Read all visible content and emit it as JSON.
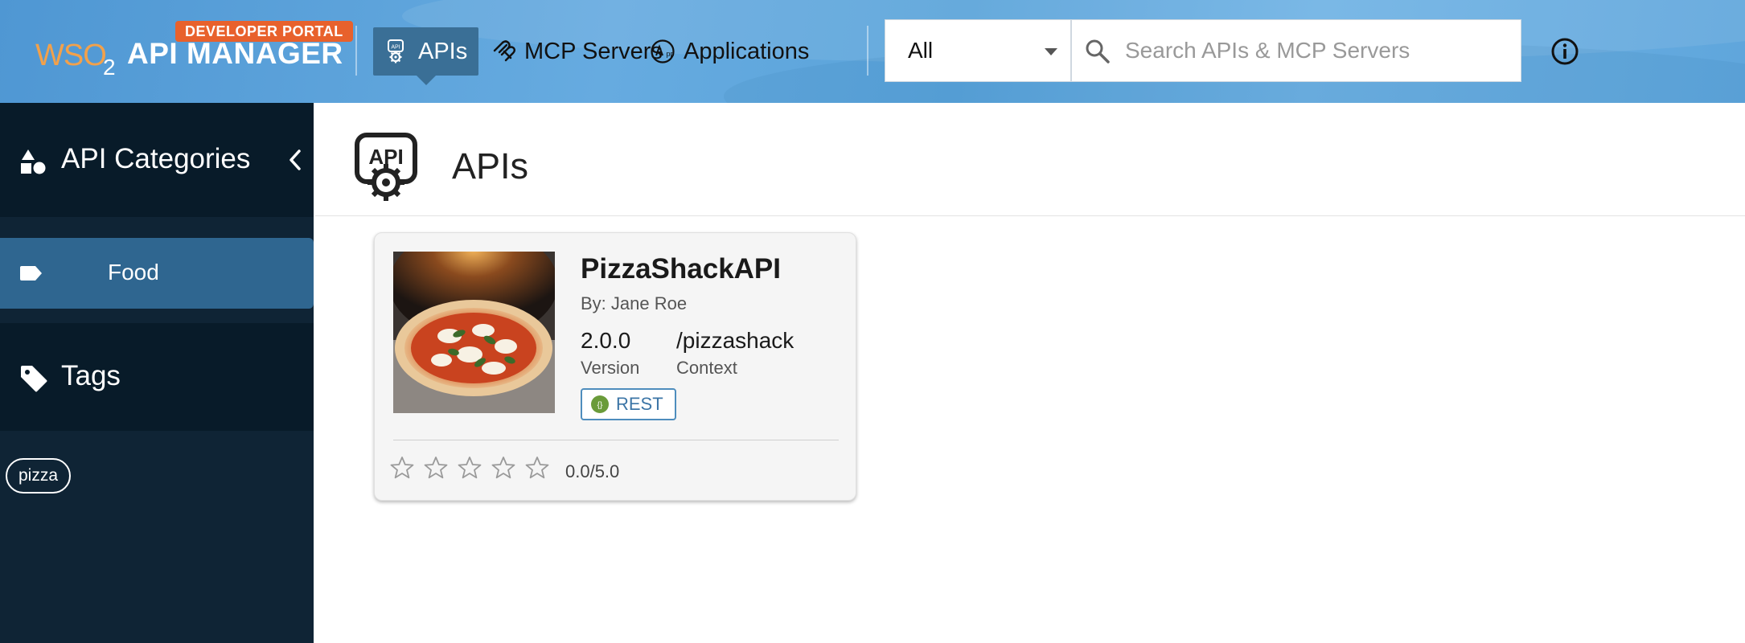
{
  "header": {
    "badge": "DEVELOPER PORTAL",
    "logo_wso": "WSO",
    "logo_two": "2",
    "product": "API MANAGER",
    "nav": [
      {
        "label": "APIs",
        "icon": "api-icon",
        "active": true
      },
      {
        "label": "MCP Servers",
        "icon": "mcp-icon",
        "active": false
      },
      {
        "label": "Applications",
        "icon": "applications-icon",
        "active": false
      }
    ],
    "filter_value": "All",
    "search_placeholder": "Search APIs & MCP Servers"
  },
  "sidebar": {
    "categories_label": "API Categories",
    "categories": [
      {
        "label": "Food",
        "selected": true
      }
    ],
    "tags_label": "Tags",
    "tags": [
      {
        "label": "pizza"
      }
    ]
  },
  "main": {
    "title": "APIs",
    "cards": [
      {
        "name": "PizzaShackAPI",
        "by": "By: Jane Roe",
        "version": "2.0.0",
        "version_label": "Version",
        "context": "/pizzashack",
        "context_label": "Context",
        "type": "REST",
        "rating": "0.0/5.0",
        "rating_value": 0,
        "rating_max": 5
      }
    ]
  },
  "colors": {
    "header_blue": "#5aa3da",
    "active_nav": "#3a6f96",
    "sidebar_bg": "#0f2435",
    "sidebar_section": "#081b29",
    "selected_category": "#2f6690",
    "badge_orange": "#e8612c",
    "rest_chip": "#3c75a6"
  }
}
